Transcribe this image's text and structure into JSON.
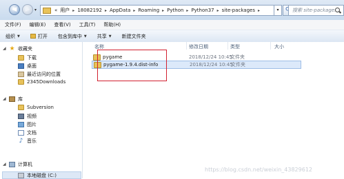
{
  "address": {
    "crumbs": [
      "«",
      "用户",
      "18082192",
      "AppData",
      "Roaming",
      "Python",
      "Python37",
      "site-packages"
    ]
  },
  "search": {
    "placeholder": "搜索 site-packages"
  },
  "menu": [
    "文件(F)",
    "编辑(E)",
    "查看(V)",
    "工具(T)",
    "帮助(H)"
  ],
  "toolbar": {
    "organize": "组织",
    "open": "打开",
    "include_library": "包含到库中",
    "share": "共享",
    "new_folder": "新建文件夹"
  },
  "sidebar": {
    "favorites": "收藏夹",
    "download": "下载",
    "desktop": "桌面",
    "recent": "最近访问的位置",
    "downloads2345": "2345Downloads",
    "libraries": "库",
    "subversion": "Subversion",
    "videos": "视频",
    "pictures": "图片",
    "documents": "文档",
    "music": "音乐",
    "computer": "计算机",
    "local_disk": "本地磁盘 (C:)"
  },
  "columns": {
    "name": "名称",
    "date": "修改日期",
    "type": "类型",
    "size": "大小"
  },
  "files": [
    {
      "name": "pygame",
      "date": "2018/12/24 10:45",
      "type": "文件夹"
    },
    {
      "name": "pygame-1.9.4.dist-info",
      "date": "2018/12/24 10:45",
      "type": "文件夹"
    }
  ],
  "watermark": "https://blog.csdn.net/weixin_43829612"
}
